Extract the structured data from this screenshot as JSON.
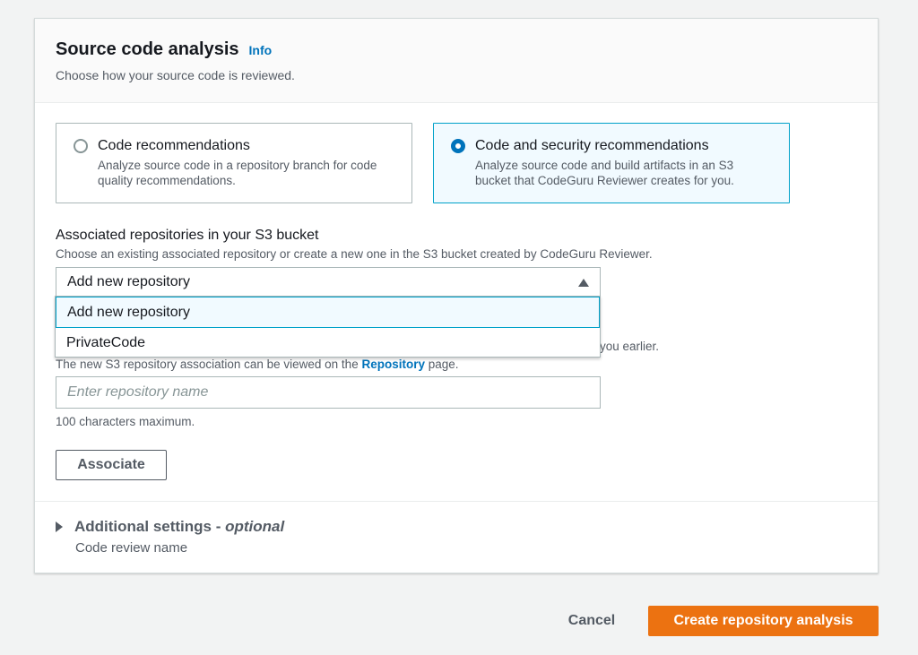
{
  "section": {
    "title": "Source code analysis",
    "info_link": "Info",
    "subtitle": "Choose how your source code is reviewed."
  },
  "options": [
    {
      "title": "Code recommendations",
      "description": "Analyze source code in a repository branch for code quality recommendations.",
      "selected": false
    },
    {
      "title": "Code and security recommendations",
      "description": "Analyze source code and build artifacts in an S3 bucket that CodeGuru Reviewer creates for you.",
      "selected": true
    }
  ],
  "repository_field": {
    "label": "Associated repositories in your S3 bucket",
    "description": "Choose an existing associated repository or create a new one in the S3 bucket created by CodeGuru Reviewer.",
    "selected_value": "Add new repository",
    "dropdown_options": [
      "Add new repository",
      "PrivateCode"
    ],
    "partial_text_end": "you earlier.",
    "note_prefix": "The new S3 repository association can be viewed on the ",
    "note_link": "Repository",
    "note_suffix": " page.",
    "name_placeholder": "Enter repository name",
    "constraint": "100 characters maximum.",
    "associate_button": "Associate"
  },
  "additional_settings": {
    "title": "Additional settings - ",
    "optional": "optional",
    "subtitle": "Code review name"
  },
  "footer": {
    "cancel": "Cancel",
    "create": "Create repository analysis"
  },
  "colors": {
    "primary_button": "#ec7211",
    "link": "#0073bb",
    "selected_tile_border": "#00a1c9",
    "selected_tile_bg": "#f1faff"
  }
}
